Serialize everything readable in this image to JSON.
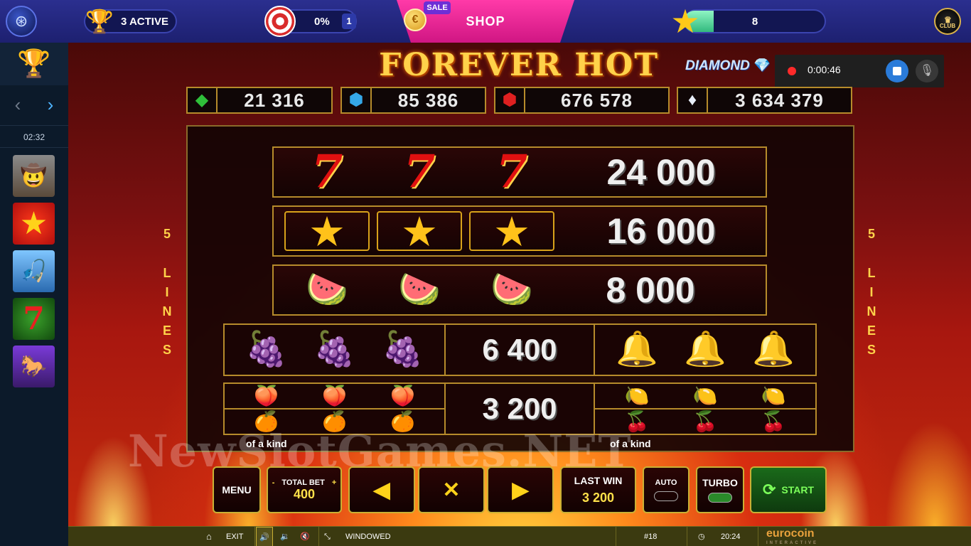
{
  "topbar": {
    "tournaments_label": "3 ACTIVE",
    "missions_percent": "0%",
    "missions_badge": "1",
    "shop_label": "SHOP",
    "sale_tag": "SALE",
    "xp_value": "8",
    "club_label": "CLUB"
  },
  "sidebar": {
    "timer": "02:32",
    "games": [
      {
        "name": "mobster-game-thumb",
        "icon": "🤠"
      },
      {
        "name": "star-game-thumb",
        "icon": "★"
      },
      {
        "name": "fishing-game-thumb",
        "icon": "🎣"
      },
      {
        "name": "sevens-game-thumb",
        "icon": "7"
      },
      {
        "name": "samurai-game-thumb",
        "icon": "🐎"
      }
    ]
  },
  "recorder": {
    "elapsed": "0:00:46"
  },
  "game": {
    "title": "FOREVER HOT",
    "brand": "DIAMOND",
    "jackpots": [
      {
        "gem": "emerald",
        "value": "21 316",
        "color": "#2fbf3a"
      },
      {
        "gem": "sapphire",
        "value": "85 386",
        "color": "#35a8e8"
      },
      {
        "gem": "ruby",
        "value": "676 578",
        "color": "#e02020"
      },
      {
        "gem": "diamond",
        "value": "3 634 379",
        "color": "#e8eef8"
      }
    ],
    "lines_count": "5",
    "lines_letters": [
      "L",
      "I",
      "N",
      "E",
      "S"
    ],
    "paytable": [
      {
        "symbol": "seven",
        "icon": "7",
        "value": "24 000"
      },
      {
        "symbol": "star",
        "icon": "★",
        "value": "16 000"
      },
      {
        "symbol": "watermelon",
        "icon": "🍉",
        "value": "8 000"
      },
      {
        "symbol_left": "grapes",
        "icon_left": "🍇",
        "symbol_right": "bell",
        "icon_right": "🔔",
        "value": "6 400"
      },
      {
        "symbol_left": "plum-orange",
        "icon_left": "🍑",
        "symbol_right": "lemon-cherry",
        "icon_right": "🍋",
        "value": "3 200"
      }
    ],
    "of_kind_label": "of a kind",
    "watermark": "NewSlotGames.NET"
  },
  "controls": {
    "menu": "MENU",
    "total_bet_label": "TOTAL BET",
    "total_bet_value": "400",
    "minus": "-",
    "plus": "+",
    "last_win_label": "LAST WIN",
    "last_win_value": "3 200",
    "auto": "AUTO",
    "turbo": "TURBO",
    "start": "START"
  },
  "statusbar": {
    "exit": "EXIT",
    "windowed": "WINDOWED",
    "round": "#18",
    "clock": "20:24",
    "provider": "eurocoin",
    "provider_sub": "INTERACTIVE"
  }
}
